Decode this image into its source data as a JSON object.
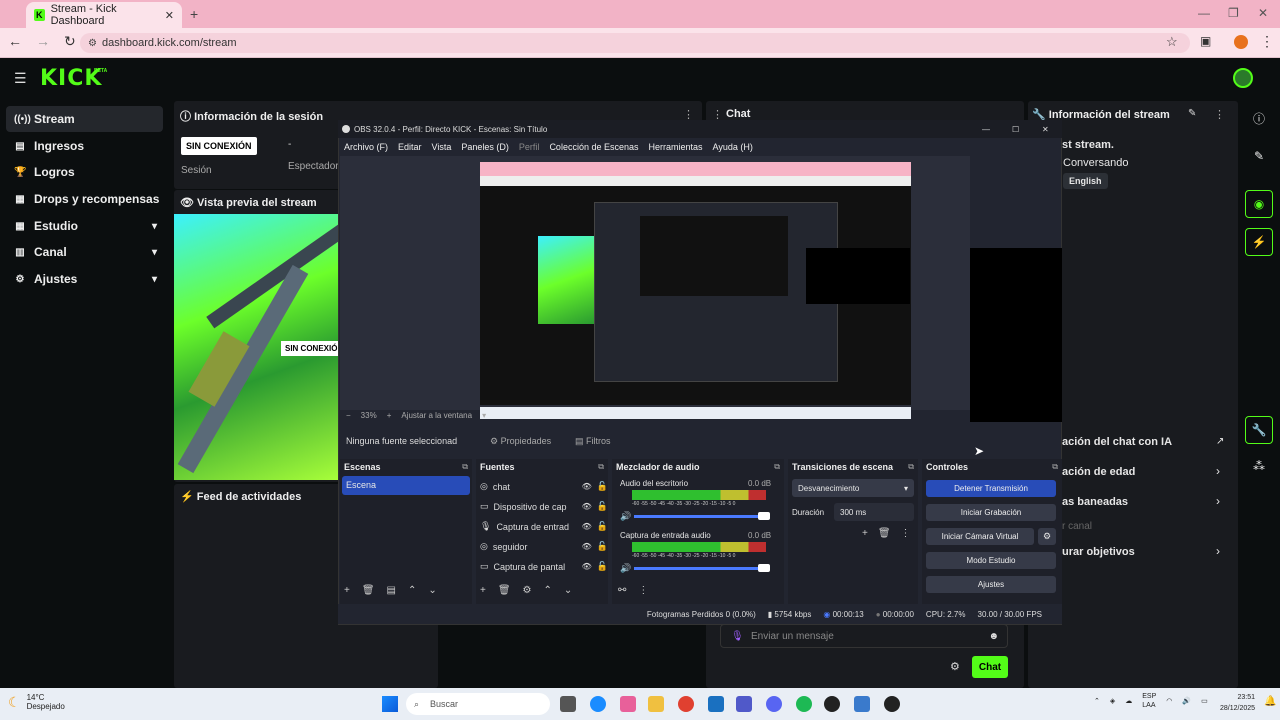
{
  "browser": {
    "tab_title": "Stream - Kick Dashboard",
    "url": "dashboard.kick.com/stream"
  },
  "kick": {
    "logo": "KICK",
    "beta": "BETA"
  },
  "sidebar": {
    "items": [
      {
        "label": "Stream",
        "icon": "broadcast-icon"
      },
      {
        "label": "Ingresos",
        "icon": "money-icon"
      },
      {
        "label": "Logros",
        "icon": "trophy-icon"
      },
      {
        "label": "Drops y recompensas",
        "icon": "gift-icon"
      },
      {
        "label": "Estudio",
        "icon": "grid-icon"
      },
      {
        "label": "Canal",
        "icon": "chart-icon"
      },
      {
        "label": "Ajustes",
        "icon": "gear-icon"
      }
    ]
  },
  "session": {
    "title": "Información de la sesión",
    "badge": "SIN CONEXIÓN",
    "sesion_label": "Sesión",
    "dash": "-",
    "viewers_label": "Espectador"
  },
  "preview": {
    "title": "Vista previa del stream",
    "badge": "SIN CONEXIÓN"
  },
  "feed": {
    "title": "Feed de actividades"
  },
  "chat": {
    "title": "Chat",
    "input_placeholder": "Enviar un mensaje",
    "send": "Chat"
  },
  "info": {
    "title": "Información del stream",
    "title_value": "st stream.",
    "category": "Conversando",
    "tag": "English",
    "rows": [
      "ación del chat con IA",
      "ación de edad",
      "as baneadas",
      "r canal",
      "urar objetivos"
    ]
  },
  "obs": {
    "window_title": "OBS 32.0.4 - Perfil: Directo KICK - Escenas: Sin Título",
    "menu": [
      "Archivo (F)",
      "Editar",
      "Vista",
      "Paneles (D)",
      "Perfil",
      "Colección de Escenas",
      "Herramientas",
      "Ayuda (H)"
    ],
    "zoom": "33%",
    "fit": "Ajustar a la ventana",
    "no_source": "Ninguna fuente seleccionad",
    "props": "Propiedades",
    "filters": "Filtros",
    "scenes_title": "Escenas",
    "scene_item": "Escena",
    "sources_title": "Fuentes",
    "sources": [
      "chat",
      "Dispositivo de cap",
      "Captura de entrad",
      "seguidor",
      "Captura de pantal"
    ],
    "mixer_title": "Mezclador de audio",
    "mixer": [
      {
        "name": "Audio del escritorio",
        "db": "0.0 dB"
      },
      {
        "name": "Captura de entrada audio",
        "db": "0.0 dB"
      }
    ],
    "scale": "-60 -55 -50 -45 -40 -35 -30 -25 -20 -15 -10 -5 0",
    "trans_title": "Transiciones de escena",
    "trans_value": "Desvanecimiento",
    "dur_label": "Duración",
    "dur_value": "300 ms",
    "controls_title": "Controles",
    "controls": [
      "Detener Transmisión",
      "Iniciar Grabación",
      "Iniciar Cámara Virtual",
      "Modo Estudio",
      "Ajustes"
    ],
    "status": {
      "dropped": "Fotogramas Perdidos 0 (0.0%)",
      "kbps": "5754 kbps",
      "live": "00:00:13",
      "rec": "00:00:00",
      "cpu": "CPU: 2.7%",
      "fps": "30.00 / 30.00 FPS"
    }
  },
  "taskbar": {
    "temp": "14°C",
    "weather": "Despejado",
    "search": "Buscar",
    "lang1": "ESP",
    "lang2": "LAA",
    "time": "23:51",
    "date": "28/12/2025"
  }
}
